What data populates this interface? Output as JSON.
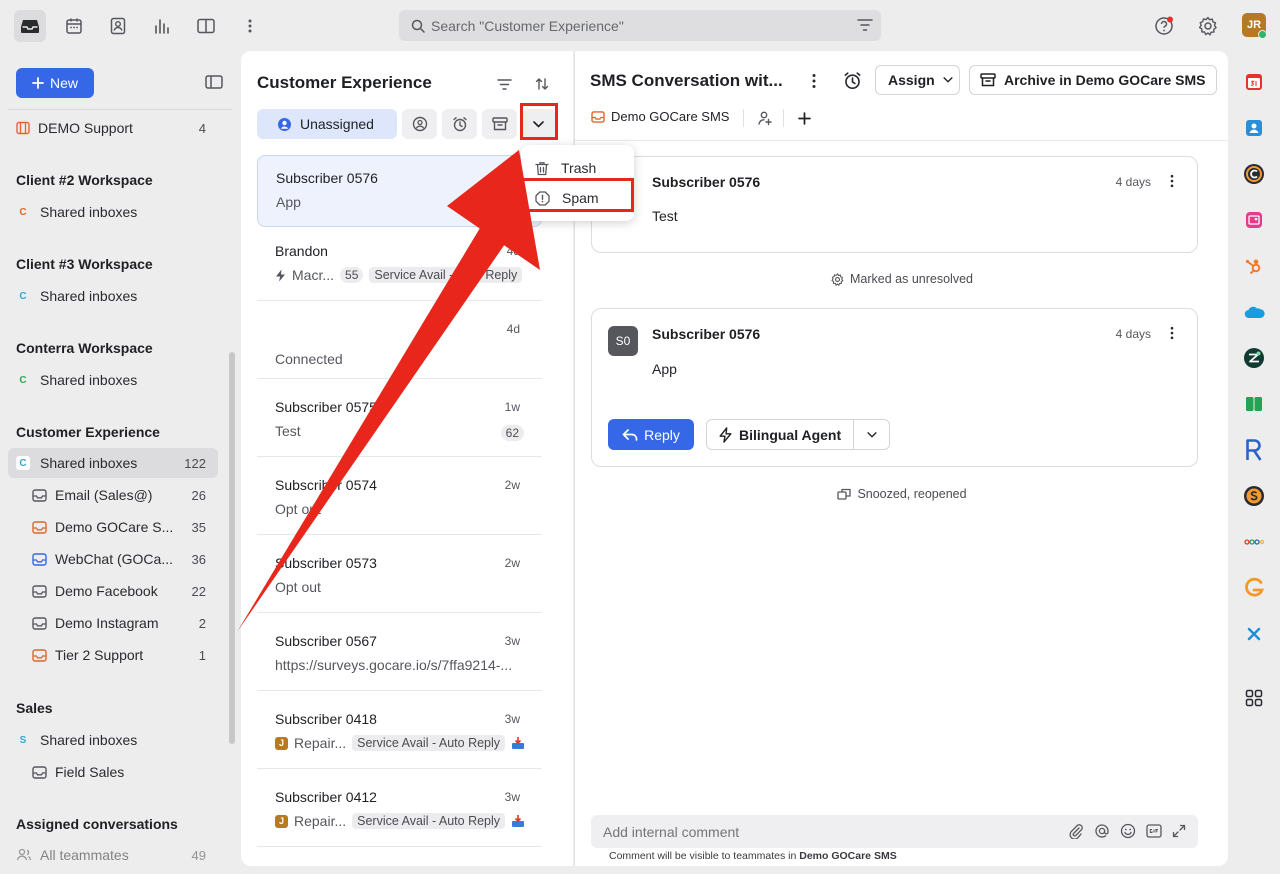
{
  "topbar": {
    "search_placeholder": "Search \"Customer Experience\"",
    "avatar": "JR"
  },
  "sidebar": {
    "new_label": "New",
    "rows": [
      {
        "label": "DEMO Support",
        "count": "4"
      },
      {
        "label": "Shared inboxes",
        "count": ""
      },
      {
        "label": "Shared inboxes",
        "count": ""
      },
      {
        "label": "Shared inboxes",
        "count": ""
      },
      {
        "label": "Shared inboxes",
        "count": "122"
      },
      {
        "label": "Email (Sales@)",
        "count": "26"
      },
      {
        "label": "Demo GOCare S...",
        "count": "35"
      },
      {
        "label": "WebChat (GOCa...",
        "count": "36"
      },
      {
        "label": "Demo Facebook",
        "count": "22"
      },
      {
        "label": "Demo Instagram",
        "count": "2"
      },
      {
        "label": "Tier 2 Support",
        "count": "1"
      },
      {
        "label": "Shared inboxes",
        "count": ""
      },
      {
        "label": "Field Sales",
        "count": ""
      },
      {
        "label": "All teammates",
        "count": "49"
      }
    ],
    "headings": [
      "Client #2 Workspace",
      "Client #3 Workspace",
      "Conterra Workspace",
      "Customer Experience",
      "Sales",
      "Assigned conversations"
    ],
    "badges": [
      "C",
      "C",
      "C",
      "C",
      "S"
    ]
  },
  "list": {
    "title": "Customer Experience",
    "filter_unassigned": "Unassigned",
    "items": [
      {
        "name": "Subscriber 0576",
        "time": "",
        "preview": "App"
      },
      {
        "name": "Brandon",
        "time": "4d",
        "preview": "Macr...",
        "pill": "55",
        "tag": "Service Avail - Auto Reply"
      },
      {
        "name": "",
        "time": "4d",
        "preview": "Connected"
      },
      {
        "name": "Subscriber 0575",
        "time": "1w",
        "preview": "Test",
        "pill": "62"
      },
      {
        "name": "Subscriber 0574",
        "time": "2w",
        "preview": "Opt out"
      },
      {
        "name": "Subscriber 0573",
        "time": "2w",
        "preview": "Opt out"
      },
      {
        "name": "Subscriber 0567",
        "time": "3w",
        "preview": "https://surveys.gocare.io/s/7ffa9214-..."
      },
      {
        "name": "Subscriber 0418",
        "time": "3w",
        "preview": "Repair...",
        "tag": "Service Avail - Auto Reply",
        "badge": "J"
      },
      {
        "name": "Subscriber 0412",
        "time": "3w",
        "preview": "Repair...",
        "tag": "Service Avail - Auto Reply",
        "badge": "J"
      }
    ]
  },
  "dropdown": {
    "trash": "Trash",
    "spam": "Spam"
  },
  "conversation": {
    "title": "SMS Conversation wit...",
    "assign": "Assign",
    "archive": "Archive in Demo GOCare SMS",
    "channel": "Demo GOCare SMS",
    "msg1": {
      "sender": "Subscriber 0576",
      "time": "4 days",
      "body": "Test"
    },
    "event1": "Marked as unresolved",
    "msg2": {
      "sender": "Subscriber 0576",
      "time": "4 days",
      "body": "App",
      "avatar": "S0"
    },
    "reply": "Reply",
    "agent": "Bilingual Agent",
    "event2": "Snoozed, reopened",
    "comment_placeholder": "Add internal comment",
    "footer_prefix": "Comment will be visible to teammates in",
    "footer_inbox": "Demo GOCare SMS"
  },
  "colors": {
    "accent": "#3567e6",
    "annotation_red": "#e8261b"
  }
}
